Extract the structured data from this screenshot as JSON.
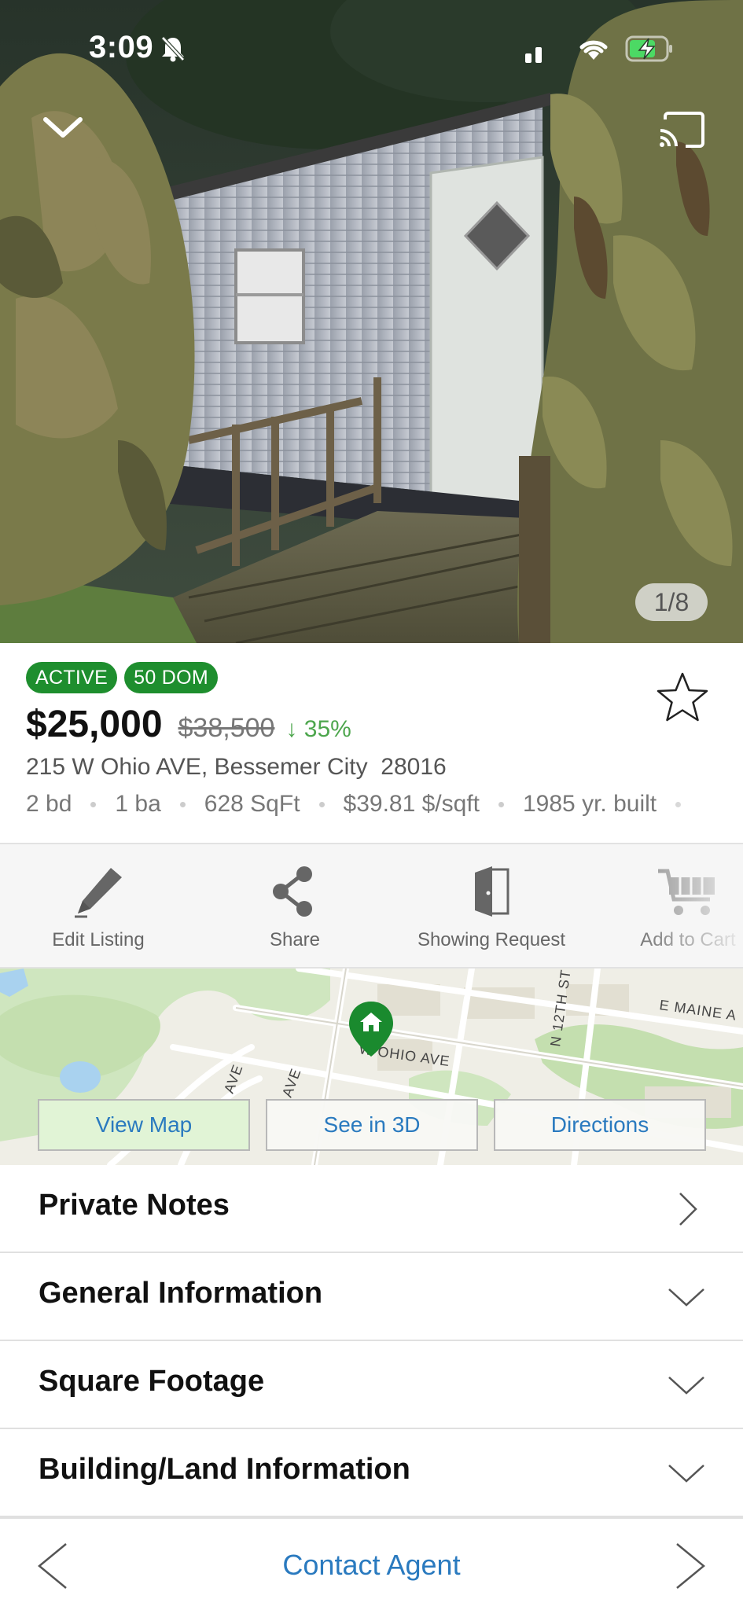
{
  "status_bar": {
    "time": "3:09"
  },
  "photo": {
    "counter": "1/8"
  },
  "listing": {
    "badges": [
      "ACTIVE",
      "50 DOM"
    ],
    "price": "$25,000",
    "original_price": "$38,500",
    "price_change": "↓ 35%",
    "address": "215 W Ohio AVE, Bessemer City  28016",
    "facts": [
      "2 bd",
      "1 ba",
      "628 SqFt",
      "$39.81 $/sqft",
      "1985 yr. built"
    ]
  },
  "actions": {
    "edit": "Edit Listing",
    "share": "Share",
    "showing": "Showing Request",
    "cart": "Add to Cart"
  },
  "map": {
    "street_labels": [
      "E MAINE A",
      "W OHIO AVE",
      "N 12TH ST",
      "AVE",
      "AVE"
    ],
    "buttons": {
      "view_map": "View Map",
      "see_3d": "See in 3D",
      "directions": "Directions"
    }
  },
  "sections": [
    {
      "title": "Private Notes",
      "icon": "chevron-right-icon"
    },
    {
      "title": "General Information",
      "icon": "chevron-down-icon"
    },
    {
      "title": "Square Footage",
      "icon": "chevron-down-icon"
    },
    {
      "title": "Building/Land Information",
      "icon": "chevron-down-icon"
    }
  ],
  "bottom_bar": {
    "contact_label": "Contact Agent"
  },
  "colors": {
    "accent": "#2a7abf",
    "badge_green": "#1e8e2e",
    "price_drop": "#4da64d"
  }
}
